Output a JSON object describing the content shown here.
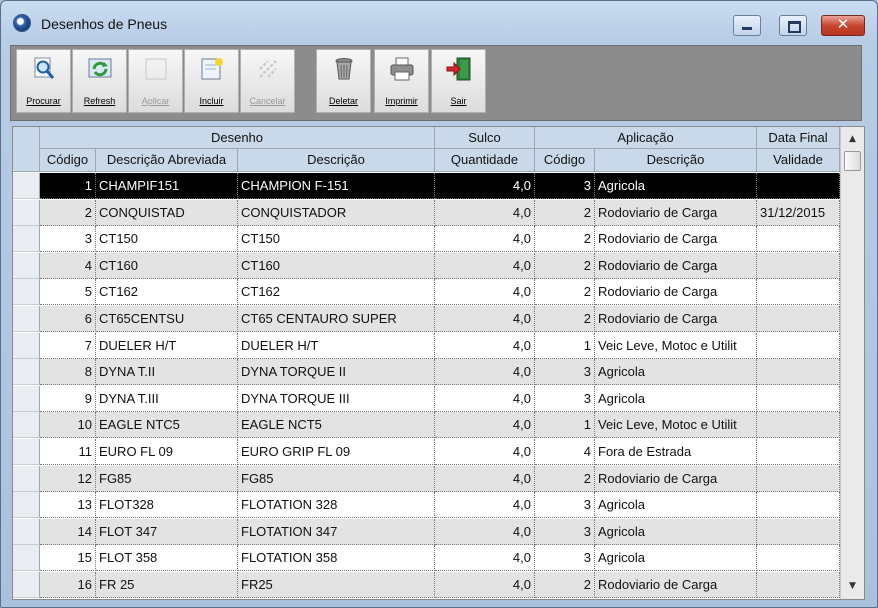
{
  "window": {
    "title": "Desenhos de Pneus",
    "close_glyph": "✕"
  },
  "toolbar": {
    "buttons": [
      {
        "label": "Procurar",
        "icon": "search-icon",
        "enabled": true
      },
      {
        "label": "Refresh",
        "icon": "refresh-icon",
        "enabled": true
      },
      {
        "label": "Aplicar",
        "icon": "apply-icon",
        "enabled": false
      },
      {
        "label": "Incluir",
        "icon": "new-document-icon",
        "enabled": true
      },
      {
        "label": "Cancelar",
        "icon": "cancel-icon",
        "enabled": false
      },
      {
        "label": "Deletar",
        "icon": "trash-icon",
        "enabled": true
      },
      {
        "label": "Imprimir",
        "icon": "printer-icon",
        "enabled": true
      },
      {
        "label": "Sair",
        "icon": "exit-door-icon",
        "enabled": true
      }
    ]
  },
  "grid": {
    "group_headers": {
      "desenho": "Desenho",
      "sulco": "Sulco",
      "aplicacao": "Aplicação",
      "data_final": "Data Final"
    },
    "columns": {
      "codigo": "Código",
      "descricao_abreviada": "Descrição Abreviada",
      "descricao": "Descrição",
      "quantidade": "Quantidade",
      "aplicacao_codigo": "Código",
      "aplicacao_descricao": "Descrição",
      "validade": "Validade"
    },
    "rows": [
      {
        "codigo": "1",
        "abrev": "CHAMPIF151",
        "descricao": "CHAMPION F-151",
        "quantidade": "4,0",
        "ap_codigo": "3",
        "ap_descricao": "Agricola",
        "data_final": ""
      },
      {
        "codigo": "2",
        "abrev": "CONQUISTAD",
        "descricao": "CONQUISTADOR",
        "quantidade": "4,0",
        "ap_codigo": "2",
        "ap_descricao": "Rodoviario de Carga",
        "data_final": "31/12/2015"
      },
      {
        "codigo": "3",
        "abrev": "CT150",
        "descricao": "CT150",
        "quantidade": "4,0",
        "ap_codigo": "2",
        "ap_descricao": "Rodoviario de Carga",
        "data_final": ""
      },
      {
        "codigo": "4",
        "abrev": "CT160",
        "descricao": "CT160",
        "quantidade": "4,0",
        "ap_codigo": "2",
        "ap_descricao": "Rodoviario de Carga",
        "data_final": ""
      },
      {
        "codigo": "5",
        "abrev": "CT162",
        "descricao": "CT162",
        "quantidade": "4,0",
        "ap_codigo": "2",
        "ap_descricao": "Rodoviario de Carga",
        "data_final": ""
      },
      {
        "codigo": "6",
        "abrev": "CT65CENTSU",
        "descricao": "CT65 CENTAURO SUPER",
        "quantidade": "4,0",
        "ap_codigo": "2",
        "ap_descricao": "Rodoviario de Carga",
        "data_final": ""
      },
      {
        "codigo": "7",
        "abrev": "DUELER H/T",
        "descricao": "DUELER H/T",
        "quantidade": "4,0",
        "ap_codigo": "1",
        "ap_descricao": "Veic Leve, Motoc e Utilit",
        "data_final": ""
      },
      {
        "codigo": "8",
        "abrev": "DYNA T.II",
        "descricao": "DYNA TORQUE II",
        "quantidade": "4,0",
        "ap_codigo": "3",
        "ap_descricao": "Agricola",
        "data_final": ""
      },
      {
        "codigo": "9",
        "abrev": "DYNA T.III",
        "descricao": "DYNA TORQUE III",
        "quantidade": "4,0",
        "ap_codigo": "3",
        "ap_descricao": "Agricola",
        "data_final": ""
      },
      {
        "codigo": "10",
        "abrev": "EAGLE NTC5",
        "descricao": "EAGLE NCT5",
        "quantidade": "4,0",
        "ap_codigo": "1",
        "ap_descricao": "Veic Leve, Motoc e Utilit",
        "data_final": ""
      },
      {
        "codigo": "11",
        "abrev": "EURO FL 09",
        "descricao": "EURO GRIP FL 09",
        "quantidade": "4,0",
        "ap_codigo": "4",
        "ap_descricao": "Fora de Estrada",
        "data_final": ""
      },
      {
        "codigo": "12",
        "abrev": "FG85",
        "descricao": "FG85",
        "quantidade": "4,0",
        "ap_codigo": "2",
        "ap_descricao": "Rodoviario de Carga",
        "data_final": ""
      },
      {
        "codigo": "13",
        "abrev": "FLOT328",
        "descricao": "FLOTATION 328",
        "quantidade": "4,0",
        "ap_codigo": "3",
        "ap_descricao": "Agricola",
        "data_final": ""
      },
      {
        "codigo": "14",
        "abrev": "FLOT 347",
        "descricao": "FLOTATION 347",
        "quantidade": "4,0",
        "ap_codigo": "3",
        "ap_descricao": "Agricola",
        "data_final": ""
      },
      {
        "codigo": "15",
        "abrev": "FLOT 358",
        "descricao": "FLOTATION 358",
        "quantidade": "4,0",
        "ap_codigo": "3",
        "ap_descricao": "Agricola",
        "data_final": ""
      },
      {
        "codigo": "16",
        "abrev": "FR 25",
        "descricao": "FR25",
        "quantidade": "4,0",
        "ap_codigo": "2",
        "ap_descricao": "Rodoviario de Carga",
        "data_final": ""
      }
    ],
    "selected_row": 0
  },
  "scrollbar": {
    "up_glyph": "▲",
    "down_glyph": "▼"
  }
}
